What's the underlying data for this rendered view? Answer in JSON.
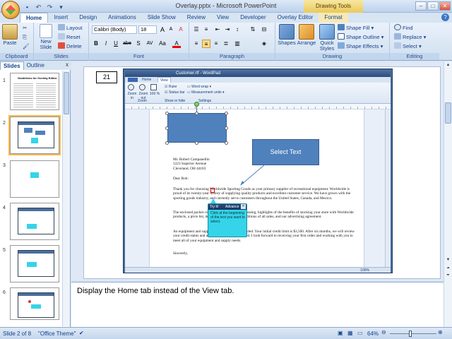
{
  "window": {
    "title": "Overlay.pptx - Microsoft PowerPoint",
    "context_tab": "Drawing Tools",
    "minimize": "–",
    "maximize": "□",
    "close": "✕"
  },
  "quick_access": [
    "save-icon",
    "undo-icon",
    "redo-icon",
    "customize-icon"
  ],
  "tabs": [
    "Home",
    "Insert",
    "Design",
    "Animations",
    "Slide Show",
    "Review",
    "View",
    "Developer",
    "Overlay Editor",
    "Format"
  ],
  "active_tab": "Home",
  "ribbon": {
    "clipboard": {
      "name": "Clipboard",
      "paste": "Paste"
    },
    "slides": {
      "name": "Slides",
      "new_slide_line1": "New",
      "new_slide_line2": "Slide",
      "layout": "Layout",
      "reset": "Reset",
      "delete": "Delete"
    },
    "font": {
      "name": "Font",
      "font_family": "Calibri (Body)",
      "font_size": "18",
      "bold": "B",
      "italic": "I",
      "underline": "U",
      "strike": "abe",
      "shadow": "S",
      "spacing": "AV",
      "case": "Aa",
      "grow": "A",
      "shrink": "A",
      "clear": "A"
    },
    "paragraph": {
      "name": "Paragraph"
    },
    "drawing": {
      "name": "Drawing",
      "shapes": "Shapes",
      "arrange": "Arrange",
      "quick_styles_line1": "Quick",
      "quick_styles_line2": "Styles",
      "shape_fill": "Shape Fill",
      "shape_outline": "Shape Outline",
      "shape_effects": "Shape Effects"
    },
    "editing": {
      "name": "Editing",
      "find": "Find",
      "replace": "Replace",
      "select": "Select"
    }
  },
  "left_pane": {
    "tabs": [
      "Slides",
      "Outline"
    ],
    "close": "x",
    "slide_numbers": [
      "1",
      "2",
      "3",
      "4",
      "5",
      "6"
    ],
    "slide1_title": "Guidelines for Overlay Editor"
  },
  "slide": {
    "number_box": "21",
    "callout": "Select Text",
    "wordpad": {
      "title": "Customer.rtf - WordPad",
      "tabs": [
        "Home",
        "View"
      ],
      "ribbon_items": [
        "Zoom in",
        "Zoom out",
        "100 %",
        "Ruler",
        "Status bar",
        "Word wrap",
        "Measurement units"
      ],
      "ribbon_groups": [
        "Zoom",
        "Show or hide",
        "Settings"
      ],
      "zoom": "100%",
      "letter": {
        "address": [
          "Mr. Robert Campanellin",
          "1223 Superior Avenue",
          "Cleveland, OH  44183"
        ],
        "greeting": "Dear Rob:",
        "p1": "Thank you for choosing Worldwide Sporting Goods as your primary supplier of recreational equipment. Worldwide is proud of its twenty-year history of supplying quality products and excellent customer service. We have grown with the sporting goods industry, and currently serve customers throughout the United States, Canada, and Mexico.",
        "p2": "The enclosed packet contains our latest product catalog, highlights of the benefits of stocking your store with Worldwide products, a price list, details of the terms and conditions of all sales, and our advertising agreement.",
        "p3": "An equipment and supply order form is also included. Your initial credit limit is $3,500. After six months, we will review your credit status and adjust the limit, as warranted. I look forward to receiving your first order and working with you to meet all of your equipment and supply needs.",
        "closing": "Sincerely,"
      }
    },
    "tryit": {
      "label": "Try It!",
      "advance": "Advance",
      "close": "✕",
      "text": "Click at the beginning of the text you want to select."
    }
  },
  "notes": "Display the Home tab instead of the View tab.",
  "status": {
    "slide": "Slide 2 of 8",
    "theme": "\"Office Theme\"",
    "zoom": "64%"
  },
  "colors": {
    "accent": "#4f81bd",
    "tryit": "#35d4e8",
    "ribbon": "#dbe6f4"
  }
}
